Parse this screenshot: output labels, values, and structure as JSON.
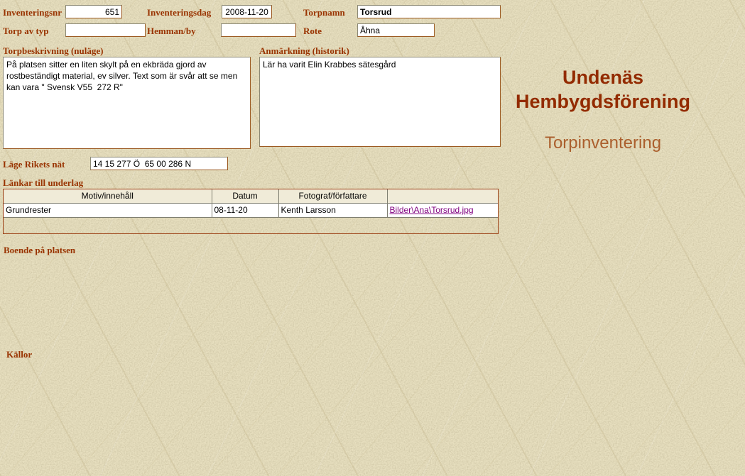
{
  "branding": {
    "org_name": "Undenäs Hembygdsförening",
    "app_title": "Torpinventering"
  },
  "form": {
    "inventeringsnr": {
      "label": "Inventeringsnr",
      "value": "651"
    },
    "inventeringsdag": {
      "label": "Inventeringsdag",
      "value": "2008-11-20"
    },
    "torpnamn": {
      "label": "Torpnamn",
      "value": "Torsrud"
    },
    "torp_av_typ": {
      "label": "Torp av typ",
      "value": ""
    },
    "hemman_by": {
      "label": "Hemman/by",
      "value": ""
    },
    "rote": {
      "label": "Rote",
      "value": "Åhna"
    },
    "torpbeskrivning": {
      "label": "Torpbeskrivning (nuläge)",
      "value": "På platsen sitter en liten skylt på en ekbräda gjord av rostbeständigt material, ev silver. Text som är svår att se men kan vara \" Svensk V55  272 R\""
    },
    "anmarkning": {
      "label": "Anmärkning (historik)",
      "value": "Lär ha varit Elin Krabbes sätesgård"
    },
    "lage_rikets_nat": {
      "label": "Läge Rikets nät",
      "value": "14 15 277 Ö  65 00 286 N"
    }
  },
  "underlag": {
    "section_label": "Länkar till underlag",
    "headers": [
      "Motiv/innehåll",
      "Datum",
      "Fotograf/författare",
      ""
    ],
    "rows": [
      {
        "motiv": "Grundrester",
        "datum": "08-11-20",
        "fotograf": "Kenth Larsson",
        "link": "Bilder\\Ana\\Torsrud.jpg"
      }
    ]
  },
  "sections": {
    "boende_label": "Boende på platsen",
    "kallor_label": "Källor"
  },
  "colors": {
    "page_bg": "#e7dfbf",
    "label_accent": "#993300",
    "org_title": "#932b00",
    "subtitle": "#ab5f2d",
    "visited_link": "#800080",
    "table_border": "#9a3c10",
    "table_header_bg": "#f0ebd8"
  }
}
